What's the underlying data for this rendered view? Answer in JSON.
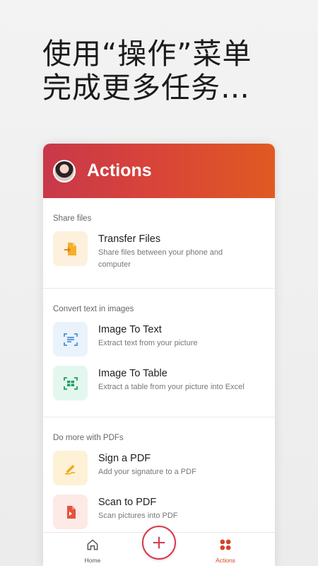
{
  "headline": {
    "line1": "使用“操作”菜单",
    "line2": "完成更多任务…"
  },
  "app": {
    "title": "Actions",
    "header_gradient": [
      "#c8384a",
      "#e05a22"
    ]
  },
  "sections": [
    {
      "title": "Share files",
      "items": [
        {
          "title": "Transfer Files",
          "subtitle": "Share files between your phone and computer",
          "icon": "transfer-icon"
        }
      ]
    },
    {
      "title": "Convert text in images",
      "items": [
        {
          "title": "Image To Text",
          "subtitle": "Extract text from your picture",
          "icon": "image-text-icon"
        },
        {
          "title": "Image To Table",
          "subtitle": "Extract a table from your picture into Excel",
          "icon": "image-table-icon"
        }
      ]
    },
    {
      "title": "Do more with PDFs",
      "items": [
        {
          "title": "Sign a PDF",
          "subtitle": "Add your signature to a PDF",
          "icon": "signature-icon"
        },
        {
          "title": "Scan to PDF",
          "subtitle": "Scan pictures into PDF",
          "icon": "scan-pdf-icon"
        }
      ]
    }
  ],
  "nav": {
    "home_label": "Home",
    "actions_label": "Actions",
    "fab_icon": "plus-icon",
    "accent": "#d4442c"
  }
}
